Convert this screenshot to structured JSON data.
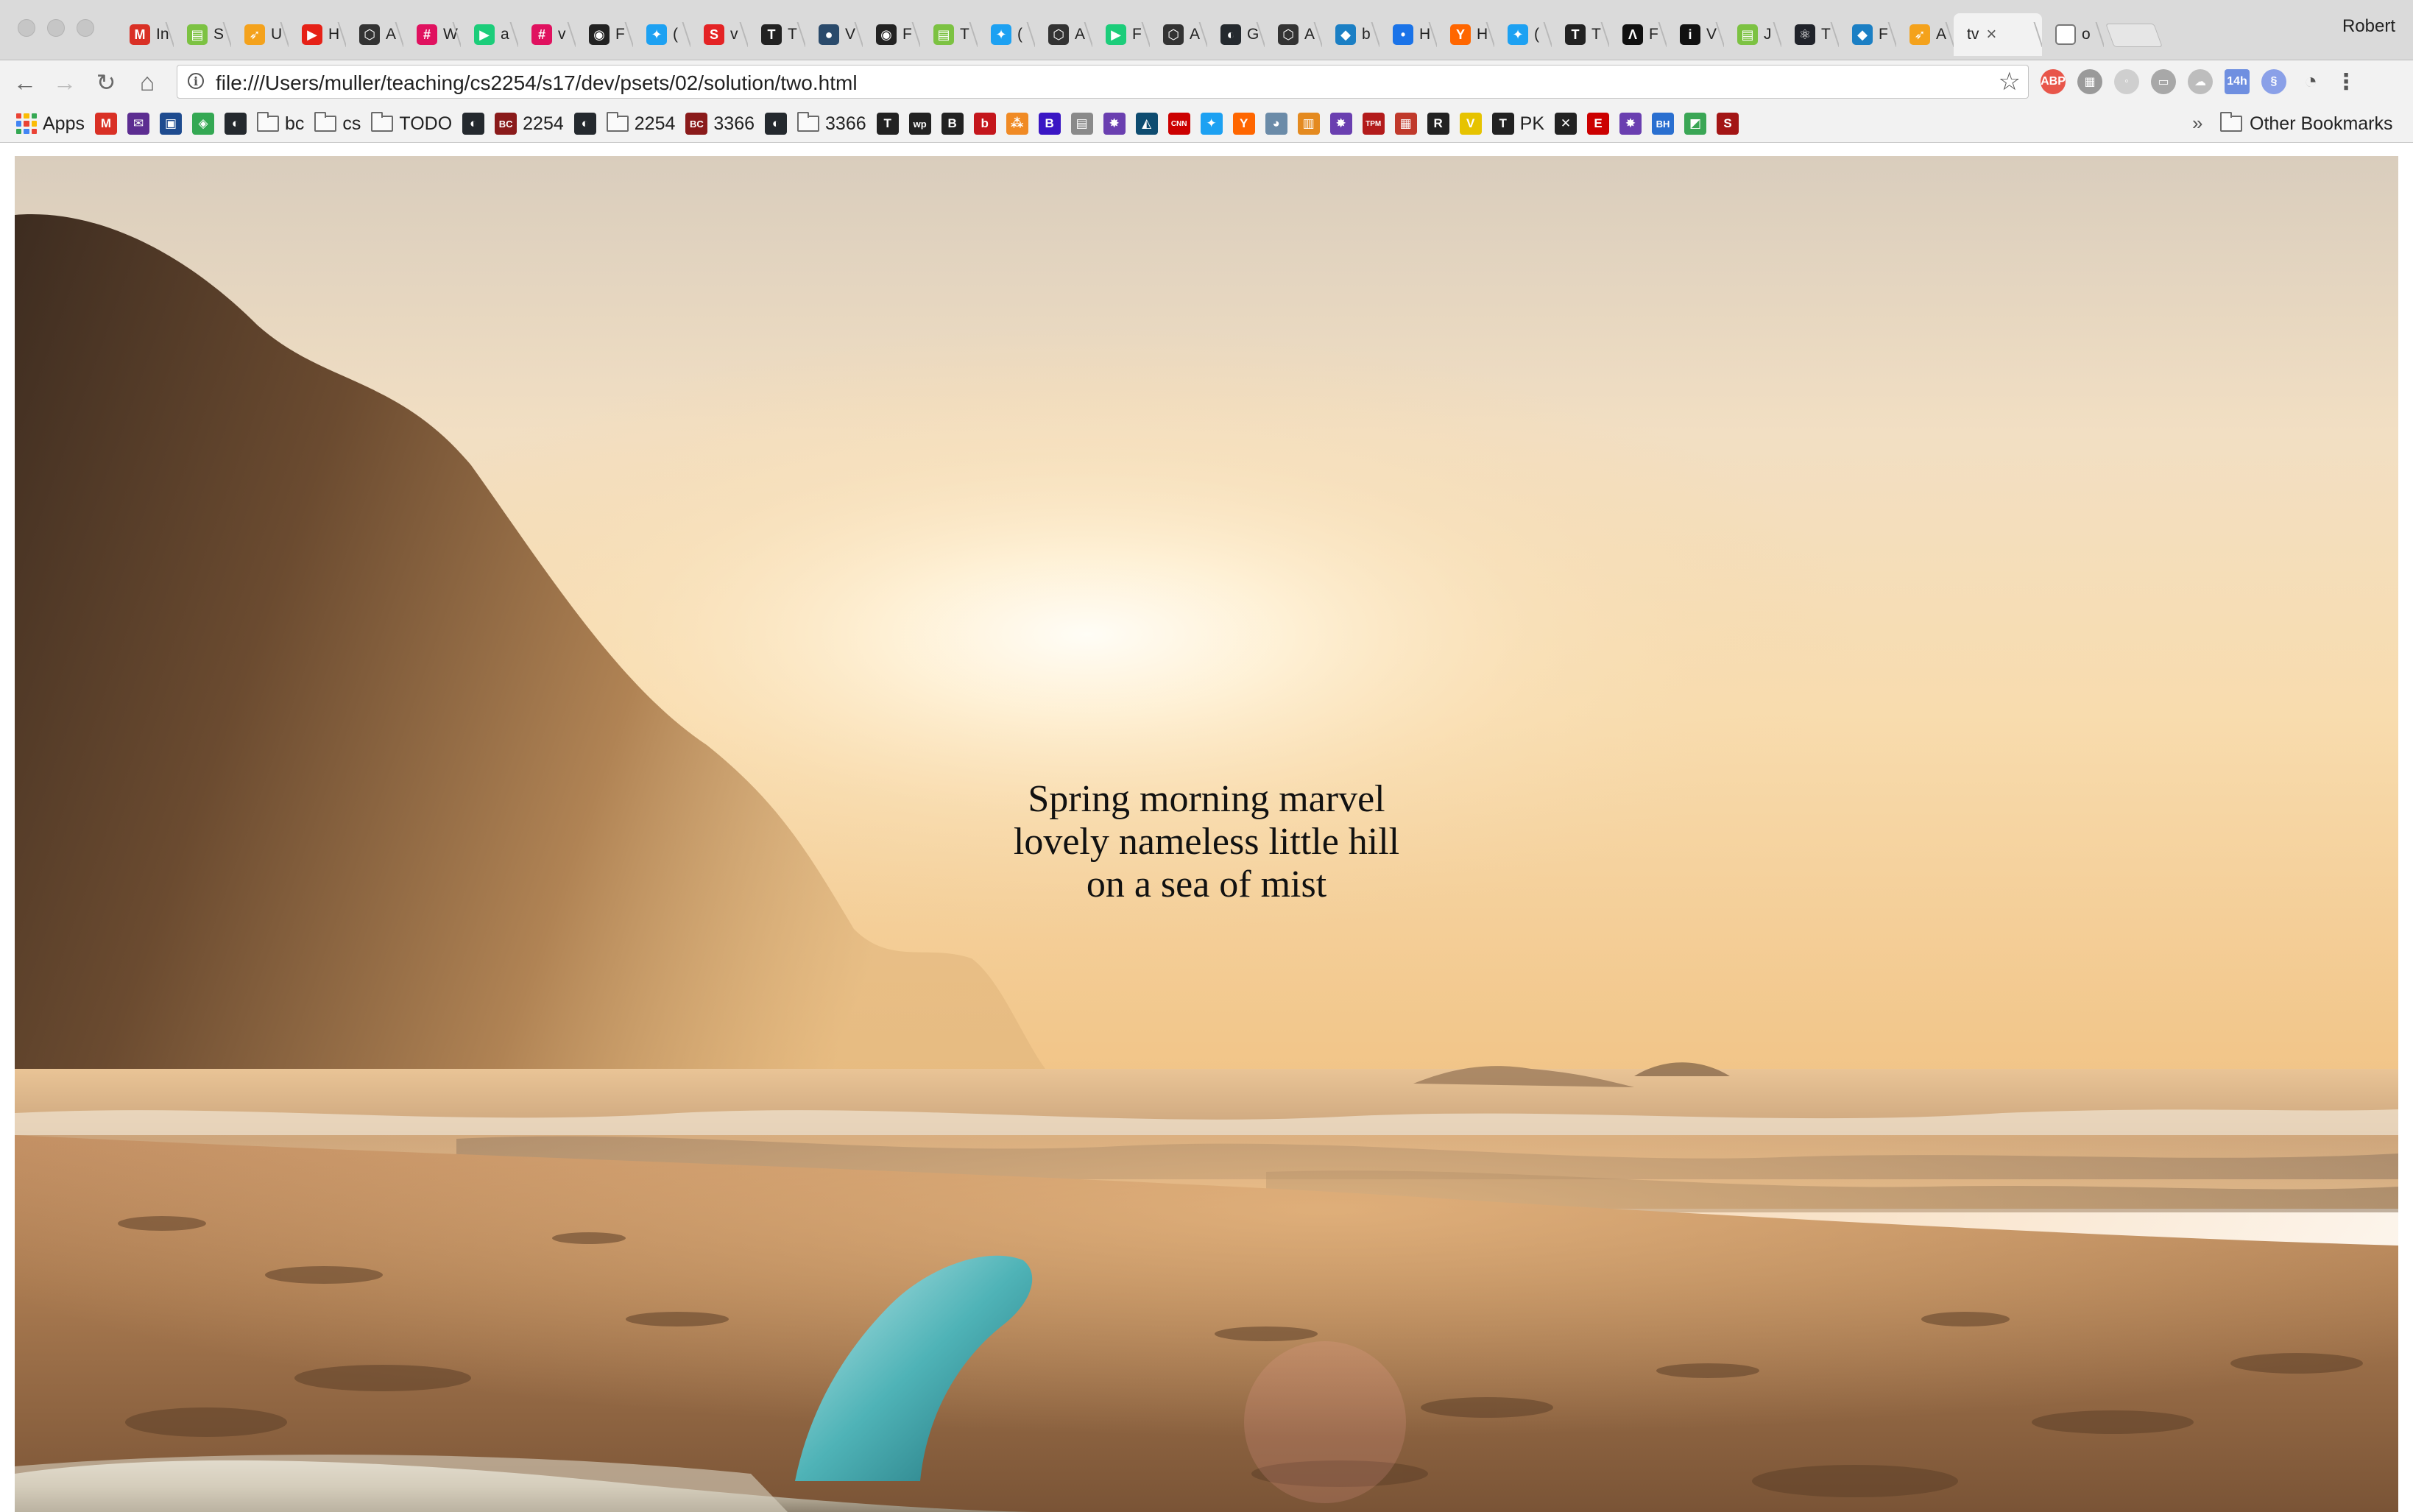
{
  "tabs": [
    {
      "favicon": "gmail-icon",
      "letter": "M",
      "color": "#d93025",
      "text": "In"
    },
    {
      "favicon": "chart-icon",
      "letter": "▤",
      "color": "#7cc242",
      "text": "S"
    },
    {
      "favicon": "slack-icon",
      "letter": "➶",
      "color": "#f4a21c",
      "text": "U"
    },
    {
      "favicon": "youtube-icon",
      "letter": "▶",
      "color": "#e62117",
      "text": "H"
    },
    {
      "favicon": "codepen-icon",
      "letter": "⬡",
      "color": "#333333",
      "text": "A"
    },
    {
      "favicon": "jsbin-icon",
      "letter": "#",
      "color": "#e0115f",
      "text": "W"
    },
    {
      "favicon": "play-icon",
      "letter": "▶",
      "color": "#1ccd7a",
      "text": "a"
    },
    {
      "favicon": "jsbin-icon",
      "letter": "#",
      "color": "#e0115f",
      "text": "v"
    },
    {
      "favicon": "camera-icon",
      "letter": "◉",
      "color": "#222222",
      "text": "F"
    },
    {
      "favicon": "twitter-icon",
      "letter": "✦",
      "color": "#1da1f2",
      "text": "("
    },
    {
      "favicon": "s-icon",
      "letter": "S",
      "color": "#e42325",
      "text": "v"
    },
    {
      "favicon": "nyt-icon",
      "letter": "T",
      "color": "#222222",
      "text": "T"
    },
    {
      "favicon": "globe-icon",
      "letter": "●",
      "color": "#2a4a6b",
      "text": "V"
    },
    {
      "favicon": "camera-icon",
      "letter": "◉",
      "color": "#222222",
      "text": "F"
    },
    {
      "favicon": "chart-icon",
      "letter": "▤",
      "color": "#7cc242",
      "text": "T"
    },
    {
      "favicon": "twitter-icon",
      "letter": "✦",
      "color": "#1da1f2",
      "text": "("
    },
    {
      "favicon": "codepen-icon",
      "letter": "⬡",
      "color": "#333333",
      "text": "A"
    },
    {
      "favicon": "play-icon",
      "letter": "▶",
      "color": "#1ccd7a",
      "text": "F"
    },
    {
      "favicon": "codepen-icon",
      "letter": "⬡",
      "color": "#333333",
      "text": "A"
    },
    {
      "favicon": "github-icon",
      "letter": "◐",
      "color": "#24292e",
      "text": "G"
    },
    {
      "favicon": "codepen-icon",
      "letter": "⬡",
      "color": "#333333",
      "text": "A"
    },
    {
      "favicon": "blog-icon",
      "letter": "◆",
      "color": "#1b7fc4",
      "text": "b"
    },
    {
      "favicon": "dots-icon",
      "letter": "•",
      "color": "#1a73e8",
      "text": "H"
    },
    {
      "favicon": "ycombinator-icon",
      "letter": "Y",
      "color": "#ff6600",
      "text": "H"
    },
    {
      "favicon": "twitter-icon",
      "letter": "✦",
      "color": "#1da1f2",
      "text": "("
    },
    {
      "favicon": "nyt-icon",
      "letter": "T",
      "color": "#222222",
      "text": "T"
    },
    {
      "favicon": "arrow-icon",
      "letter": "Λ",
      "color": "#111111",
      "text": "F"
    },
    {
      "favicon": "info-icon",
      "letter": "i",
      "color": "#111111",
      "text": "V"
    },
    {
      "favicon": "chart-icon",
      "letter": "▤",
      "color": "#7cc242",
      "text": "J"
    },
    {
      "favicon": "react-icon",
      "letter": "⚛",
      "color": "#20232a",
      "text": "T"
    },
    {
      "favicon": "blog-icon",
      "letter": "◆",
      "color": "#1b7fc4",
      "text": "F"
    },
    {
      "favicon": "slack-icon",
      "letter": "➶",
      "color": "#f4a21c",
      "text": "A"
    }
  ],
  "active_tab": {
    "text": "tv",
    "close": "×"
  },
  "last_tab": {
    "favicon": "page-icon",
    "text": "o"
  },
  "profile_name": "Robert",
  "nav": {
    "back": "←",
    "forward": "→",
    "reload": "↻",
    "home": "⌂"
  },
  "address_bar": {
    "info": "i",
    "url": "file:///Users/muller/teaching/cs2254/s17/dev/psets/02/solution/two.html",
    "star": "☆"
  },
  "extensions": [
    {
      "name": "adblock-icon",
      "label": "ABP",
      "color": "#e8564a"
    },
    {
      "name": "qr-icon",
      "label": "▦",
      "color": "#9a9a9a"
    },
    {
      "name": "search-ext-icon",
      "label": "◦",
      "color": "#cfcfcf"
    },
    {
      "name": "save-ext-icon",
      "label": "▭",
      "color": "#a8a8a8"
    },
    {
      "name": "cloud-icon",
      "label": "☁",
      "color": "#bdbdbd"
    },
    {
      "name": "calendar-icon",
      "label": "14h",
      "color": "#6f8fe0"
    },
    {
      "name": "link-ext-icon",
      "label": "§",
      "color": "#8aa0e8"
    },
    {
      "name": "speed-icon",
      "label": "◔",
      "color": "#555555"
    },
    {
      "name": "menu-icon",
      "label": "⋮",
      "color": "#555555"
    }
  ],
  "bookmarks": [
    {
      "kind": "apps",
      "label": "Apps"
    },
    {
      "kind": "icon",
      "icon": "gmail-icon",
      "glyph": "M",
      "color": "#d93025",
      "label": ""
    },
    {
      "kind": "icon",
      "icon": "mail-icon",
      "glyph": "✉",
      "color": "#5c2d91",
      "label": ""
    },
    {
      "kind": "icon",
      "icon": "news-icon",
      "glyph": "▣",
      "color": "#1e4b8f",
      "label": ""
    },
    {
      "kind": "icon",
      "icon": "maps-icon",
      "glyph": "◈",
      "color": "#34a853",
      "label": ""
    },
    {
      "kind": "icon",
      "icon": "github-icon",
      "glyph": "◐",
      "color": "#24292e",
      "label": ""
    },
    {
      "kind": "folder",
      "label": "bc"
    },
    {
      "kind": "folder",
      "label": "cs"
    },
    {
      "kind": "folder",
      "label": "TODO"
    },
    {
      "kind": "icon",
      "icon": "github-icon",
      "glyph": "◐",
      "color": "#24292e",
      "label": ""
    },
    {
      "kind": "icon",
      "icon": "bc-icon",
      "glyph": "BC",
      "color": "#8a1a1a",
      "label": "2254"
    },
    {
      "kind": "icon",
      "icon": "github-icon",
      "glyph": "◐",
      "color": "#24292e",
      "label": ""
    },
    {
      "kind": "folder",
      "label": "2254"
    },
    {
      "kind": "icon",
      "icon": "bc-icon",
      "glyph": "BC",
      "color": "#8a1a1a",
      "label": "3366"
    },
    {
      "kind": "icon",
      "icon": "github-icon",
      "glyph": "◐",
      "color": "#24292e",
      "label": ""
    },
    {
      "kind": "folder",
      "label": "3366"
    },
    {
      "kind": "icon",
      "icon": "nyt-icon",
      "glyph": "T",
      "color": "#222222",
      "label": ""
    },
    {
      "kind": "icon",
      "icon": "wapo-icon",
      "glyph": "wp",
      "color": "#222222",
      "label": ""
    },
    {
      "kind": "icon",
      "icon": "globe-icon",
      "glyph": "B",
      "color": "#222222",
      "label": ""
    },
    {
      "kind": "icon",
      "icon": "b-icon",
      "glyph": "b",
      "color": "#c4161c",
      "label": ""
    },
    {
      "kind": "icon",
      "icon": "dots-icon",
      "glyph": "⁂",
      "color": "#f08a24",
      "label": ""
    },
    {
      "kind": "icon",
      "icon": "bbc-icon",
      "glyph": "B",
      "color": "#3a16c4",
      "label": ""
    },
    {
      "kind": "icon",
      "icon": "news-icon",
      "glyph": "▤",
      "color": "#8a8a8a",
      "label": ""
    },
    {
      "kind": "icon",
      "icon": "nbc-icon",
      "glyph": "✸",
      "color": "#6a3fb0",
      "label": ""
    },
    {
      "kind": "icon",
      "icon": "seahawk-icon",
      "glyph": "◭",
      "color": "#0e4c70",
      "label": ""
    },
    {
      "kind": "icon",
      "icon": "cnn-icon",
      "glyph": "CNN",
      "color": "#cc0000",
      "label": ""
    },
    {
      "kind": "icon",
      "icon": "twitter-icon",
      "glyph": "✦",
      "color": "#1da1f2",
      "label": ""
    },
    {
      "kind": "icon",
      "icon": "ycombinator-icon",
      "glyph": "Y",
      "color": "#ff6600",
      "label": ""
    },
    {
      "kind": "icon",
      "icon": "reddit-icon",
      "glyph": "◕",
      "color": "#6b8ba8",
      "label": ""
    },
    {
      "kind": "icon",
      "icon": "chart-icon",
      "glyph": "▥",
      "color": "#e48a20",
      "label": ""
    },
    {
      "kind": "icon",
      "icon": "nbc-icon",
      "glyph": "✸",
      "color": "#6a3fb0",
      "label": ""
    },
    {
      "kind": "icon",
      "icon": "tpm-icon",
      "glyph": "TPM",
      "color": "#b31b1b",
      "label": ""
    },
    {
      "kind": "icon",
      "icon": "news-icon",
      "glyph": "▦",
      "color": "#c0392b",
      "label": ""
    },
    {
      "kind": "icon",
      "icon": "r-icon",
      "glyph": "R",
      "color": "#222222",
      "label": ""
    },
    {
      "kind": "icon",
      "icon": "v-icon",
      "glyph": "V",
      "color": "#e6c300",
      "label": ""
    },
    {
      "kind": "icon",
      "icon": "nyt-icon",
      "glyph": "T",
      "color": "#222222",
      "label": "PK"
    },
    {
      "kind": "icon",
      "icon": "xkcd-icon",
      "glyph": "✕",
      "color": "#222222",
      "label": ""
    },
    {
      "kind": "icon",
      "icon": "espn-icon",
      "glyph": "E",
      "color": "#cc0000",
      "label": ""
    },
    {
      "kind": "icon",
      "icon": "nbc-icon",
      "glyph": "✸",
      "color": "#6a3fb0",
      "label": ""
    },
    {
      "kind": "icon",
      "icon": "bh-icon",
      "glyph": "BH",
      "color": "#2a6fd0",
      "label": ""
    },
    {
      "kind": "icon",
      "icon": "map-icon",
      "glyph": "◩",
      "color": "#3aa655",
      "label": ""
    },
    {
      "kind": "icon",
      "icon": "s-icon",
      "glyph": "S",
      "color": "#a31515",
      "label": ""
    }
  ],
  "bookmark_overflow": "»",
  "other_bookmarks": "Other Bookmarks",
  "page": {
    "haiku": [
      "Spring morning marvel",
      "lovely nameless little hill",
      "on a sea of mist"
    ]
  }
}
